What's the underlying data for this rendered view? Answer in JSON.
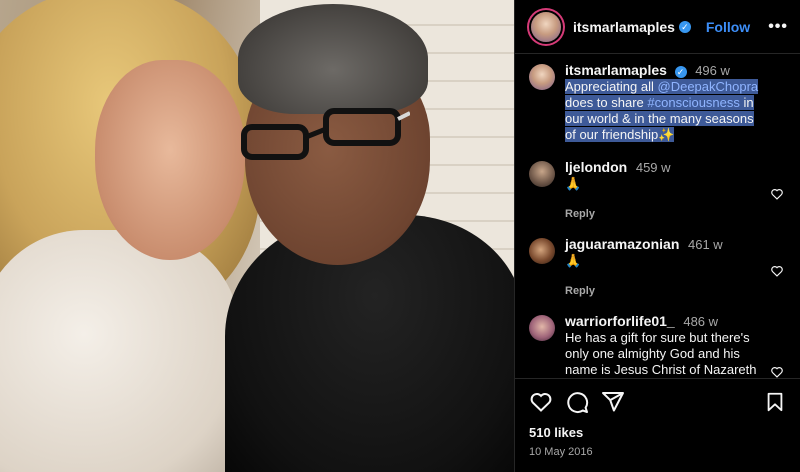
{
  "post": {
    "username": "itsmarlamaples",
    "follow_label": "Follow",
    "more_label": "•••",
    "caption": {
      "username": "itsmarlamaples",
      "time": "496 w",
      "text_prefix": "Appreciating all ",
      "mention": "@DeepakChopra",
      "text_mid": " does to share ",
      "hashtag": "#consciousness",
      "text_suffix": " in our world & in the many seasons of our friendship✨"
    },
    "comments": [
      {
        "username": "ljelondon",
        "time": "459 w",
        "text": "🙏",
        "reply_label": "Reply"
      },
      {
        "username": "jaguaramazonian",
        "time": "461 w",
        "text": "🙏",
        "reply_label": "Reply"
      },
      {
        "username": "warriorforlife01_",
        "time": "486 w",
        "text": "He has a gift for sure but there's only one almighty God and his name is Jesus Christ of Nazareth who died for the world !! Jesus saves and he is the only way to God and heaven"
      }
    ],
    "likes": "510 likes",
    "date": "10 May 2016"
  },
  "icons": {
    "verified": "verified-badge-icon",
    "heart": "heart-icon",
    "comment": "comment-icon",
    "share": "share-icon",
    "save": "bookmark-icon"
  },
  "colors": {
    "accent": "#3d8ef7",
    "verified": "#3897f0",
    "highlight": "#3e5a98",
    "background": "#000000"
  }
}
